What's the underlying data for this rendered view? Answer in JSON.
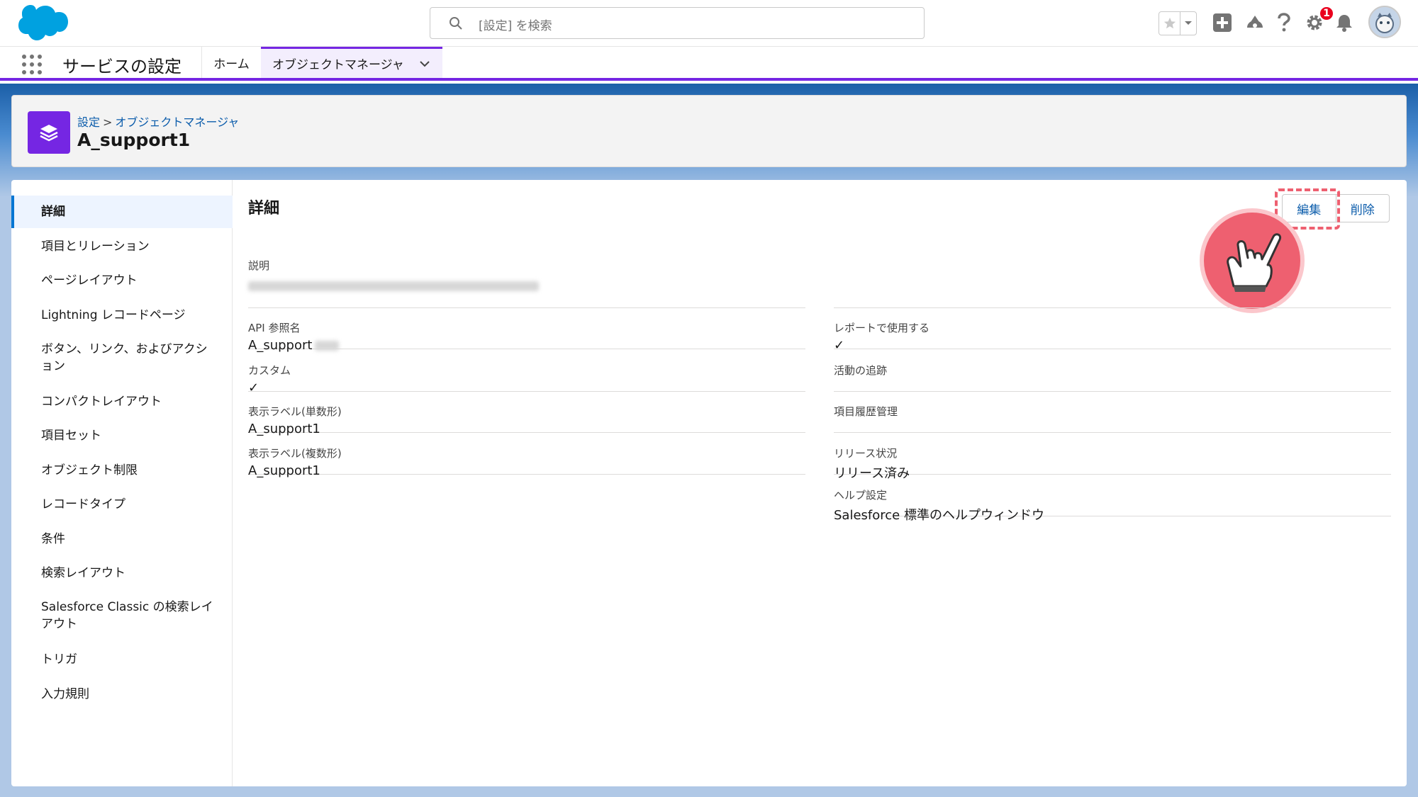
{
  "header": {
    "search_placeholder": "[設定] を検索",
    "notification_count": "1"
  },
  "app_nav": {
    "app_name": "サービスの設定",
    "tabs": [
      {
        "label": "ホーム"
      },
      {
        "label": "オブジェクトマネージャ"
      }
    ]
  },
  "object_header": {
    "breadcrumb": [
      "設定",
      "オブジェクトマネージャ"
    ],
    "title": "A_support1"
  },
  "sidebar": {
    "items": [
      {
        "label": "詳細"
      },
      {
        "label": "項目とリレーション"
      },
      {
        "label": "ページレイアウト"
      },
      {
        "label": "Lightning レコードページ"
      },
      {
        "label": "ボタン、リンク、およびアクション"
      },
      {
        "label": "コンパクトレイアウト"
      },
      {
        "label": "項目セット"
      },
      {
        "label": "オブジェクト制限"
      },
      {
        "label": "レコードタイプ"
      },
      {
        "label": "条件"
      },
      {
        "label": "検索レイアウト"
      },
      {
        "label": "Salesforce Classic の検索レイアウト"
      },
      {
        "label": "トリガ"
      },
      {
        "label": "入力規則"
      }
    ]
  },
  "detail": {
    "title": "詳細",
    "edit_button": "編集",
    "delete_button": "削除",
    "description_label": "説明",
    "left": [
      {
        "label": "API 参照名",
        "value": "A_support"
      },
      {
        "label": "カスタム",
        "value": "✓"
      },
      {
        "label": "表示ラベル(単数形)",
        "value": "A_support1"
      },
      {
        "label": "表示ラベル(複数形)",
        "value": "A_support1"
      }
    ],
    "right": [
      {
        "label": "レポートで使用する",
        "value": "✓"
      },
      {
        "label": "活動の追跡",
        "value": ""
      },
      {
        "label": "項目履歴管理",
        "value": ""
      },
      {
        "label": "リリース状況",
        "value": "リリース済み"
      },
      {
        "label": "ヘルプ設定",
        "value": "Salesforce 標準のヘルプウィンドウ"
      }
    ]
  },
  "colors": {
    "brand_purple": "#7526e3",
    "link_blue": "#0b5cab",
    "highlight_pink": "#ee6070"
  }
}
